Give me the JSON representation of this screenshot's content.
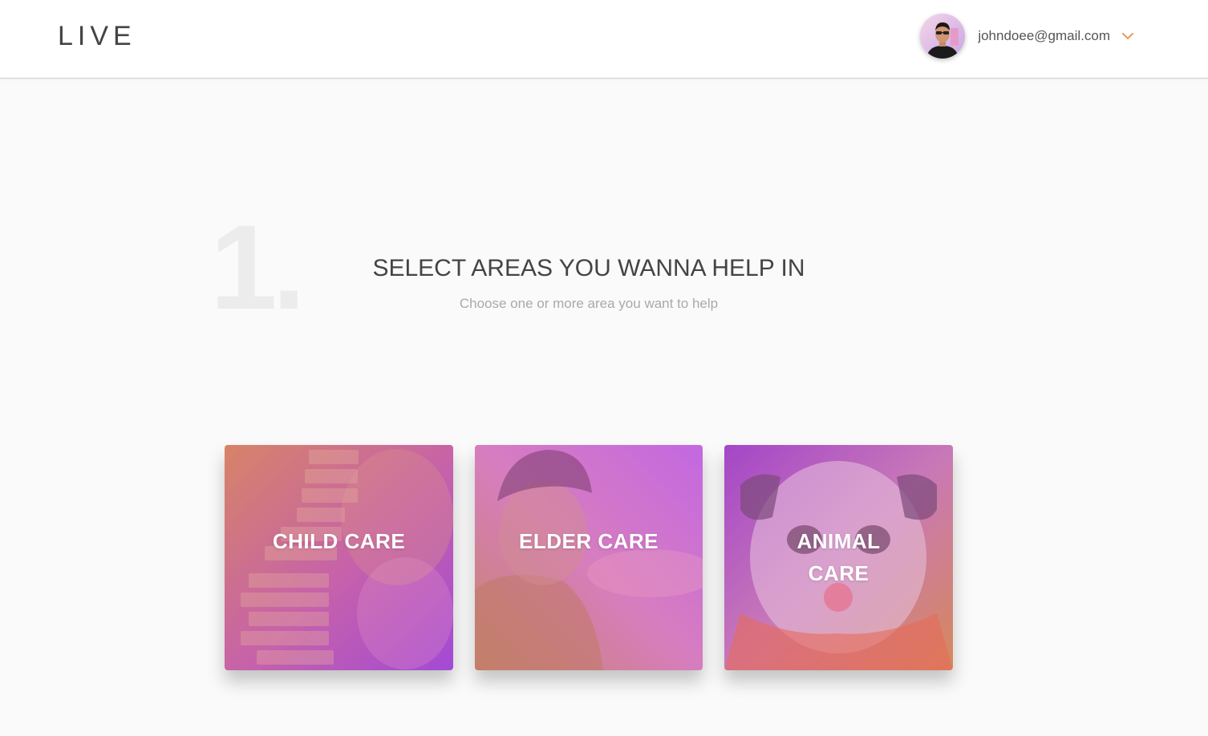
{
  "header": {
    "logo": "LIVE",
    "user": {
      "email": "johndoee@gmail.com",
      "avatar_icon": "user-avatar",
      "dropdown_icon": "chevron-down-icon",
      "accent_color": "#e8a066"
    }
  },
  "step": {
    "number": "1.",
    "title": "SELECT AREAS YOU WANNA HELP IN",
    "subtitle": "Choose one or more area you want to help"
  },
  "areas": [
    {
      "line1": "CHILD CARE",
      "line2": ""
    },
    {
      "line1": "ELDER CARE",
      "line2": ""
    },
    {
      "line1": "ANIMAL",
      "line2": "CARE"
    }
  ],
  "colors": {
    "card_gradient_start": "#e08a50",
    "card_gradient_end": "#b04ad8"
  }
}
